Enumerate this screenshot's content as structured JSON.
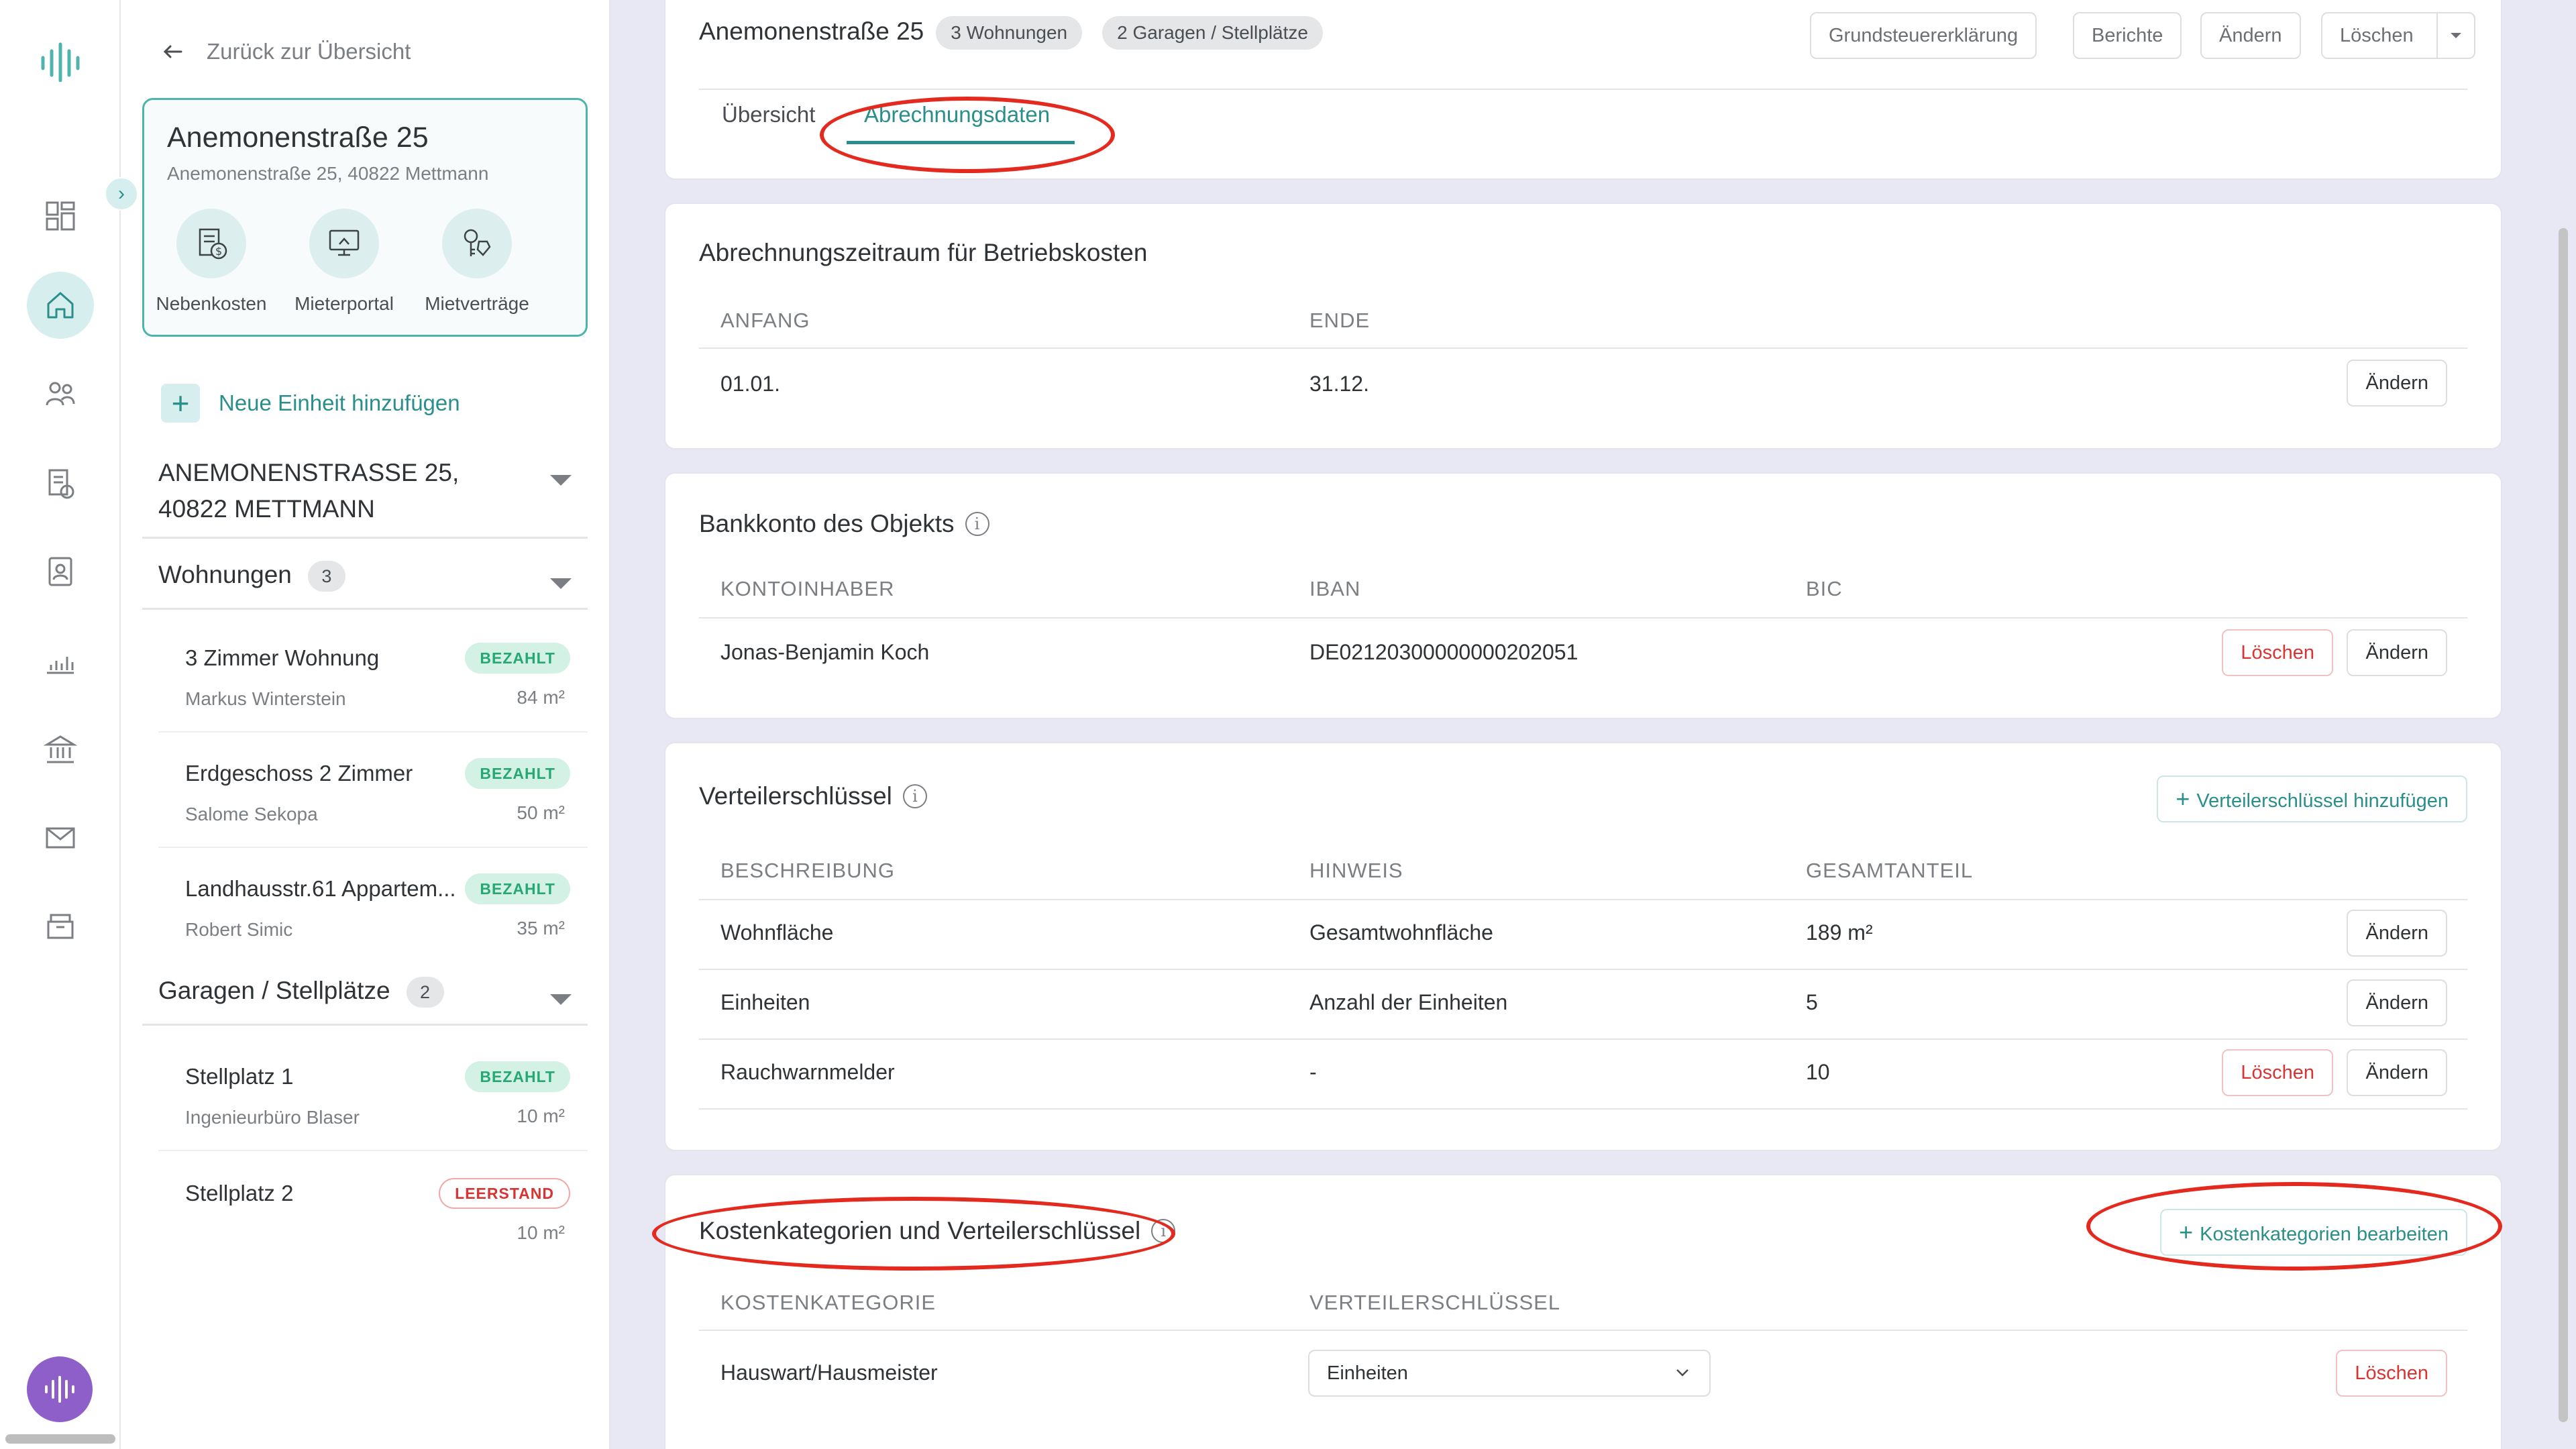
{
  "rail": {
    "icons": [
      "logo-icon",
      "dashboard-icon",
      "home-icon",
      "people-icon",
      "billing-icon",
      "contact-card-icon",
      "chart-icon",
      "bank-icon",
      "mail-icon",
      "archive-icon",
      "voice-assistant-icon"
    ]
  },
  "sidebar": {
    "back_label": "Zurück zur Übersicht",
    "property": {
      "title": "Anemonenstraße 25",
      "address": "Anemonenstraße 25, 40822 Mettmann",
      "actions": [
        {
          "label": "Nebenkosten",
          "icon": "receipt-icon"
        },
        {
          "label": "Mieterportal",
          "icon": "monitor-icon"
        },
        {
          "label": "Mietverträge",
          "icon": "keys-icon"
        }
      ]
    },
    "add_unit_label": "Neue Einheit hinzufügen",
    "building_title_line1": "ANEMONENSTRASSE 25,",
    "building_title_line2": "40822 METTMANN",
    "groups": [
      {
        "title": "Wohnungen",
        "count": "3",
        "units": [
          {
            "name": "3 Zimmer Wohnung",
            "tenant": "Markus Winterstein",
            "size": "84 m²",
            "status": "BEZAHLT"
          },
          {
            "name": "Erdgeschoss 2 Zimmer",
            "tenant": "Salome Sekopa",
            "size": "50 m²",
            "status": "BEZAHLT"
          },
          {
            "name": "Landhausstr.61 Appartem...",
            "tenant": "Robert Simic",
            "size": "35 m²",
            "status": "BEZAHLT"
          }
        ]
      },
      {
        "title": "Garagen / Stellplätze",
        "count": "2",
        "units": [
          {
            "name": "Stellplatz 1",
            "tenant": "Ingenieurbüro Blaser",
            "size": "10 m²",
            "status": "BEZAHLT"
          },
          {
            "name": "Stellplatz 2",
            "tenant": "",
            "size": "10 m²",
            "status": "LEERSTAND"
          }
        ]
      }
    ]
  },
  "header": {
    "title": "Anemonenstraße 25",
    "tag_units": "3 Wohnungen",
    "tag_garages": "2 Garagen / Stellplätze",
    "buttons": {
      "tax": "Grundsteuererklärung",
      "reports": "Berichte",
      "edit": "Ändern",
      "delete": "Löschen"
    },
    "tabs": [
      "Übersicht",
      "Abrechnungsdaten"
    ],
    "active_tab": "Abrechnungsdaten"
  },
  "billing_period": {
    "title": "Abrechnungszeitraum für Betriebskosten",
    "headers": [
      "ANFANG",
      "ENDE"
    ],
    "start": "01.01.",
    "end": "31.12.",
    "edit_label": "Ändern"
  },
  "bank_account": {
    "title": "Bankkonto des Objekts",
    "headers": [
      "KONTOINHABER",
      "IBAN",
      "BIC"
    ],
    "holder": "Jonas-Benjamin Koch",
    "iban": "DE02120300000000202051",
    "bic": "",
    "delete_label": "Löschen",
    "edit_label": "Ändern"
  },
  "distribution_keys": {
    "title": "Verteilerschlüssel",
    "add_label": "Verteilerschlüssel hinzufügen",
    "headers": [
      "BESCHREIBUNG",
      "HINWEIS",
      "GESAMTANTEIL"
    ],
    "rows": [
      {
        "description": "Wohnfläche",
        "hint": "Gesamtwohnfläche",
        "total": "189 m²",
        "deletable": false
      },
      {
        "description": "Einheiten",
        "hint": "Anzahl der Einheiten",
        "total": "5",
        "deletable": false
      },
      {
        "description": "Rauchwarnmelder",
        "hint": "-",
        "total": "10",
        "deletable": true
      }
    ],
    "delete_label": "Löschen",
    "edit_label": "Ändern"
  },
  "cost_categories": {
    "title": "Kostenkategorien und Verteilerschlüssel",
    "edit_label": "Kostenkategorien bearbeiten",
    "headers": [
      "KOSTENKATEGORIE",
      "VERTEILERSCHLÜSSEL"
    ],
    "rows": [
      {
        "category": "Hauswart/Hausmeister",
        "key": "Einheiten"
      }
    ],
    "delete_label": "Löschen"
  },
  "colors": {
    "accent": "#2a8f8a",
    "annotation": "#e4291e",
    "paid": "#26a874",
    "vacant": "#d93434",
    "voice": "#8e5fc9"
  }
}
